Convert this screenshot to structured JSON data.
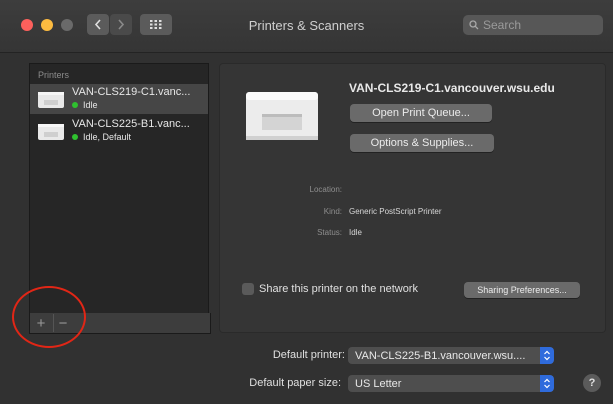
{
  "window": {
    "title": "Printers & Scanners"
  },
  "search": {
    "placeholder": "Search"
  },
  "sidebar": {
    "header": "Printers",
    "items": [
      {
        "name": "VAN-CLS219-C1.vanc...",
        "status": "Idle",
        "selected": true
      },
      {
        "name": "VAN-CLS225-B1.vanc...",
        "status": "Idle, Default",
        "selected": false
      }
    ],
    "add_label": "+",
    "remove_label": "−"
  },
  "detail": {
    "printer_name": "VAN-CLS219-C1.vancouver.wsu.edu",
    "open_queue_label": "Open Print Queue...",
    "options_label": "Options & Supplies...",
    "location_label": "Location:",
    "location_value": "",
    "kind_label": "Kind:",
    "kind_value": "Generic PostScript Printer",
    "status_label": "Status:",
    "status_value": "Idle",
    "share_label": "Share this printer on the network",
    "share_checked": false,
    "sharing_prefs_label": "Sharing Preferences..."
  },
  "prefs": {
    "default_printer_label": "Default printer:",
    "default_printer_value": "VAN-CLS225-B1.vancouver.wsu....",
    "paper_size_label": "Default paper size:",
    "paper_size_value": "US Letter",
    "help_label": "?"
  },
  "colors": {
    "accent": "#2f6bdc",
    "status_idle": "#2fc12f",
    "annotation": "#e12616"
  }
}
